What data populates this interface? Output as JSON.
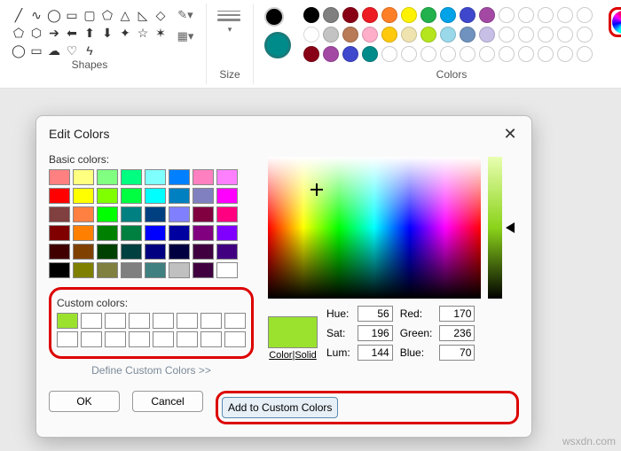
{
  "ribbon": {
    "shapes_label": "Shapes",
    "size_label": "Size",
    "colors_label": "Colors",
    "palette_row1": [
      "#000000",
      "#7f7f7f",
      "#880015",
      "#ed1c24",
      "#ff7f27",
      "#fff200",
      "#22b14c",
      "#00a2e8",
      "#3f48cc",
      "#a349a4",
      "#ffffff",
      "#ffffff",
      "#ffffff",
      "#ffffff",
      "#ffffff"
    ],
    "palette_row2": [
      "#ffffff",
      "#c3c3c3",
      "#b97a57",
      "#ffaec9",
      "#ffc90e",
      "#efe4b0",
      "#b5e61d",
      "#99d9ea",
      "#7092be",
      "#c8bfe7",
      "#ffffff",
      "#ffffff",
      "#ffffff",
      "#ffffff",
      "#ffffff"
    ],
    "palette_row3": [
      "#880015",
      "#a349a4",
      "#3f48cc",
      "#008b8b",
      "#ffffff",
      "#ffffff",
      "#ffffff",
      "#ffffff",
      "#ffffff",
      "#ffffff",
      "#ffffff",
      "#ffffff",
      "#ffffff",
      "#ffffff",
      "#ffffff"
    ],
    "empties_row1": [
      true,
      true,
      true,
      true,
      true
    ],
    "empties_row2": [
      true,
      true,
      true,
      true,
      true
    ]
  },
  "dialog": {
    "title": "Edit Colors",
    "basic_label": "Basic colors:",
    "custom_label": "Custom colors:",
    "define_link": "Define Custom Colors >>",
    "ok": "OK",
    "cancel": "Cancel",
    "add": "Add to Custom Colors",
    "preview_label": "Color|Solid",
    "hue_label": "Hue:",
    "sat_label": "Sat:",
    "lum_label": "Lum:",
    "red_label": "Red:",
    "green_label": "Green:",
    "blue_label": "Blue:",
    "hue": "56",
    "sat": "196",
    "lum": "144",
    "red": "170",
    "green": "236",
    "blue": "70",
    "basic_colors": [
      "#ff8080",
      "#ffff80",
      "#80ff80",
      "#00ff80",
      "#80ffff",
      "#0080ff",
      "#ff80c0",
      "#ff80ff",
      "#ff0000",
      "#ffff00",
      "#80ff00",
      "#00ff40",
      "#00ffff",
      "#0080c0",
      "#8080c0",
      "#ff00ff",
      "#804040",
      "#ff8040",
      "#00ff00",
      "#008080",
      "#004080",
      "#8080ff",
      "#800040",
      "#ff0080",
      "#800000",
      "#ff8000",
      "#008000",
      "#008040",
      "#0000ff",
      "#0000a0",
      "#800080",
      "#8000ff",
      "#400000",
      "#804000",
      "#004000",
      "#004040",
      "#000080",
      "#000040",
      "#400040",
      "#400080",
      "#000000",
      "#808000",
      "#808040",
      "#808080",
      "#408080",
      "#c0c0c0",
      "#400040",
      "#ffffff"
    ],
    "custom_colors": [
      "#9be22f",
      "#ffffff",
      "#ffffff",
      "#ffffff",
      "#ffffff",
      "#ffffff",
      "#ffffff",
      "#ffffff",
      "#ffffff",
      "#ffffff",
      "#ffffff",
      "#ffffff",
      "#ffffff",
      "#ffffff",
      "#ffffff",
      "#ffffff"
    ]
  },
  "watermark": "wsxdn.com"
}
